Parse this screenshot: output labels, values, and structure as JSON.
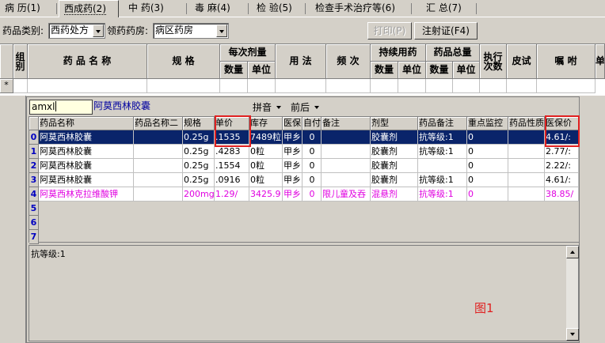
{
  "tabs": [
    {
      "label": "病 历(1)",
      "active": false
    },
    {
      "label": "西成药(2)",
      "active": true
    },
    {
      "label": "中 药(3)",
      "active": false
    },
    {
      "label": "毒 麻(4)",
      "active": false
    },
    {
      "label": "检 验(5)",
      "active": false
    },
    {
      "label": "检查手术治疗等(6)",
      "active": false
    },
    {
      "label": "汇 总(7)",
      "active": false
    }
  ],
  "filter": {
    "category_label": "药品类别:",
    "category_value": "西药处方",
    "pharmacy_label": "领药药房:",
    "pharmacy_value": "病区药房",
    "print_label": "打印(P)",
    "injection_label": "注射证(F4)"
  },
  "main_grid": {
    "headers": {
      "group": "组别",
      "drug_name": "药 品 名 称",
      "spec": "规 格",
      "dose_group": "每次剂量",
      "dose_qty": "数量",
      "dose_unit": "单位",
      "usage": "用 法",
      "frequency": "频 次",
      "continuous_group": "持续用药",
      "cont_qty": "数量",
      "cont_unit": "单位",
      "total_group": "药品总量",
      "total_qty": "数量",
      "total_unit": "单位",
      "exec_times": "执行次数",
      "skin_test": "皮试",
      "instruction": "嘱 咐",
      "extra": "单"
    },
    "new_row_marker": "*"
  },
  "lookup": {
    "search_value": "amxl",
    "matched_name": "阿莫西林胶囊",
    "menu_pinyin": "拼音",
    "menu_order": "前后",
    "columns": [
      "药品名称",
      "药品名称二",
      "规格",
      "单价",
      "库存",
      "医保",
      "自付",
      "备注",
      "剂型",
      "药品备注",
      "重点监控",
      "药品性质",
      "医保价"
    ],
    "row_numbers": [
      "0",
      "1",
      "2",
      "3",
      "4",
      "5",
      "6",
      "7"
    ],
    "rows": [
      {
        "name": "阿莫西林胶囊",
        "name2": "",
        "spec": "0.25g",
        "price": ".1535",
        "stock": "7489粒",
        "insurance": "甲乡",
        "selfpay": "0",
        "note": "",
        "form": "胶囊剂",
        "drug_note": "抗等级:1",
        "monitor": "0",
        "nature": "",
        "ins_price": "4.61/:"
      },
      {
        "name": "阿莫西林胶囊",
        "name2": "",
        "spec": "0.25g",
        "price": ".4283",
        "stock": "0粒",
        "insurance": "甲乡",
        "selfpay": "0",
        "note": "",
        "form": "胶囊剂",
        "drug_note": "抗等级:1",
        "monitor": "0",
        "nature": "",
        "ins_price": "2.77/:"
      },
      {
        "name": "阿莫西林胶囊",
        "name2": "",
        "spec": "0.25g",
        "price": ".1554",
        "stock": "0粒",
        "insurance": "甲乡",
        "selfpay": "0",
        "note": "",
        "form": "胶囊剂",
        "drug_note": "",
        "monitor": "0",
        "nature": "",
        "ins_price": "2.22/:"
      },
      {
        "name": "阿莫西林胶囊",
        "name2": "",
        "spec": "0.25g",
        "price": ".0916",
        "stock": "0粒",
        "insurance": "甲乡",
        "selfpay": "0",
        "note": "",
        "form": "胶囊剂",
        "drug_note": "抗等级:1",
        "monitor": "0",
        "nature": "",
        "ins_price": "4.61/:"
      },
      {
        "name": "阿莫西林克拉维酸钾",
        "name2": "",
        "spec": "200mg:",
        "price": "1.29/",
        "stock": "3425.9",
        "insurance": "甲乡",
        "selfpay": "0",
        "note": "限儿童及吞",
        "form": "混悬剂",
        "drug_note": "抗等级:1",
        "monitor": "0",
        "nature": "",
        "ins_price": "38.85/"
      }
    ],
    "memo_text": "抗等级:1",
    "figure_label": "图1"
  },
  "colors": {
    "selection": "#0a246a",
    "highlight_pink": "#e000e0",
    "annotation_red": "#e02020",
    "row_number_blue": "#0000c0"
  }
}
